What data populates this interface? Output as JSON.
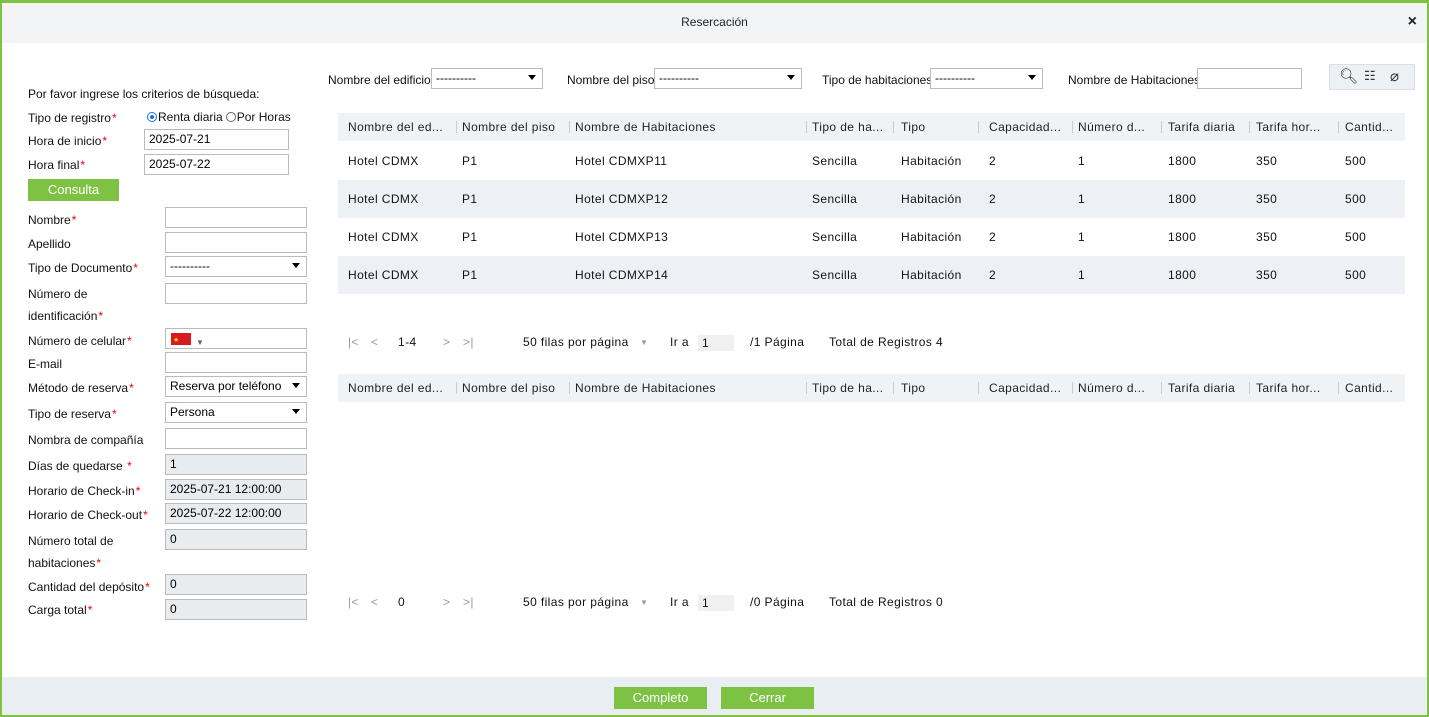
{
  "dialog": {
    "title": "Resercación",
    "close_glyph": "×"
  },
  "form": {
    "intro": "Por favor ingrese los criterios de búsqueda:",
    "registration_type": {
      "label": "Tipo de registro",
      "option_daily": "Renta diaria",
      "option_hourly": "Por Horas",
      "selected": "Renta diaria"
    },
    "start_time": {
      "label": "Hora de inicio",
      "value": "2025-07-21"
    },
    "end_time": {
      "label": "Hora final",
      "value": "2025-07-22"
    },
    "query_button": "Consulta",
    "first_name": {
      "label": "Nombre",
      "value": ""
    },
    "last_name": {
      "label": "Apellido",
      "value": ""
    },
    "doc_type": {
      "label": "Tipo de Documento",
      "value": "----------"
    },
    "id_number": {
      "label_1": "Número de",
      "label_2": "identificación",
      "value": ""
    },
    "cell_number": {
      "label": "Número de celular",
      "country": "China"
    },
    "email": {
      "label": "E-mail",
      "value": ""
    },
    "booking_method": {
      "label": "Método de reserva",
      "value": "Reserva por teléfono"
    },
    "booking_type": {
      "label": "Tipo de reserva",
      "value": "Persona"
    },
    "company_name": {
      "label": "Nombra de compañía",
      "value": ""
    },
    "days_stay": {
      "label": "Días de quedarse ",
      "value": "1"
    },
    "checkin": {
      "label": "Horario de Check-in",
      "value": "2025-07-21 12:00:00"
    },
    "checkout": {
      "label": "Horario de Check-out",
      "value": "2025-07-22 12:00:00"
    },
    "total_rooms": {
      "label_1": "Número total de",
      "label_2": "habitaciones",
      "value": "0"
    },
    "deposit": {
      "label": "Cantidad del depósito",
      "value": "0"
    },
    "total_charge": {
      "label": "Carga total",
      "value": "0"
    },
    "required_mark": "*"
  },
  "filters": {
    "building": {
      "label": "Nombre del edificio",
      "value": "----------"
    },
    "floor": {
      "label": "Nombre del piso",
      "value": "----------"
    },
    "room_type": {
      "label": "Tipo de habitaciones",
      "value": "----------"
    },
    "room_name": {
      "label": "Nombre de Habitaciones",
      "value": ""
    },
    "icons": [
      "search-icon",
      "clear-filter-icon",
      "eraser-icon"
    ]
  },
  "table": {
    "columns": [
      "Nombre del ed...",
      "Nombre del piso",
      "Nombre de Habitaciones",
      "Tipo de ha...",
      "Tipo",
      "Capacidad...",
      "Número d...",
      "Tarifa diaria",
      "Tarifa hor...",
      "Cantid..."
    ],
    "rows": [
      [
        "Hotel CDMX",
        "P1",
        "Hotel CDMXP11",
        "Sencilla",
        "Habitación",
        "2",
        "1",
        "1800",
        "350",
        "500"
      ],
      [
        "Hotel CDMX",
        "P1",
        "Hotel CDMXP12",
        "Sencilla",
        "Habitación",
        "2",
        "1",
        "1800",
        "350",
        "500"
      ],
      [
        "Hotel CDMX",
        "P1",
        "Hotel CDMXP13",
        "Sencilla",
        "Habitación",
        "2",
        "1",
        "1800",
        "350",
        "500"
      ],
      [
        "Hotel CDMX",
        "P1",
        "Hotel CDMXP14",
        "Sencilla",
        "Habitación",
        "2",
        "1",
        "1800",
        "350",
        "500"
      ]
    ]
  },
  "pager1": {
    "first": "|<",
    "prev": "<",
    "range": "1-4",
    "next": ">",
    "last": ">|",
    "per_page": "50 filas por página",
    "caret": "▼",
    "goto": "Ir a",
    "page_value": "1",
    "pages": "/1 Página",
    "total": "Total de Registros 4"
  },
  "pager2": {
    "first": "|<",
    "prev": "<",
    "range": "0",
    "next": ">",
    "last": ">|",
    "per_page": "50 filas por página",
    "caret": "▼",
    "goto": "Ir a",
    "page_value": "1",
    "pages": "/0 Página",
    "total": "Total de Registros 0"
  },
  "footer": {
    "complete": "Completo",
    "close": "Cerrar"
  },
  "colors": {
    "accent": "#7dc242",
    "required": "#ee0000",
    "radio": "#1a6fd4"
  }
}
